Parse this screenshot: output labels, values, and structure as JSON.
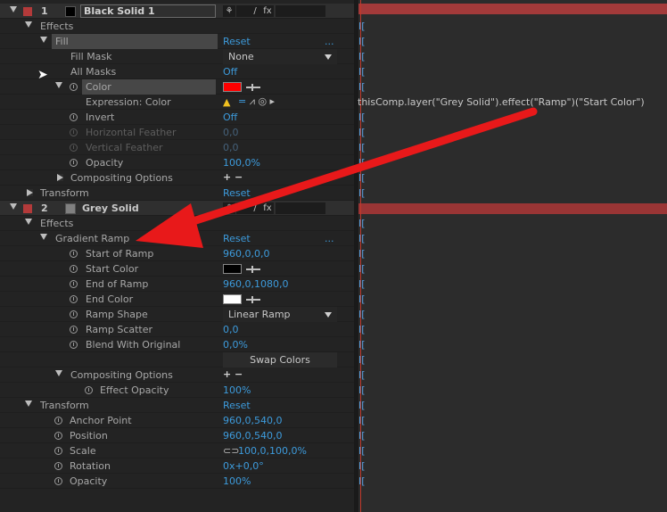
{
  "layers": [
    {
      "number": "1",
      "name": "Black Solid 1",
      "label_color": "#b33a3a",
      "source_color": "#000000"
    },
    {
      "number": "2",
      "name": "Grey Solid",
      "label_color": "#b33a3a",
      "source_color": "#808080"
    }
  ],
  "switch_labels": {
    "fx": "fx",
    "slash": "/",
    "shy": "⚘"
  },
  "rows": {
    "effects1": "Effects",
    "fill": "Fill",
    "fill_reset": "Reset",
    "fill_dots": "...",
    "fill_mask": "Fill Mask",
    "fill_mask_value": "None",
    "all_masks": "All Masks",
    "all_masks_value": "Off",
    "color": "Color",
    "color_value": "#ff0000",
    "expression_color": "Expression: Color",
    "invert": "Invert",
    "invert_value": "Off",
    "h_feather": "Horizontal Feather",
    "h_feather_value": "0,0",
    "v_feather": "Vertical Feather",
    "v_feather_value": "0,0",
    "opacity1": "Opacity",
    "opacity1_value": "100,0%",
    "comp_opts1": "Compositing Options",
    "comp_opts_value": "+ −",
    "transform1": "Transform",
    "transform1_reset": "Reset",
    "effects2": "Effects",
    "gradient_ramp": "Gradient Ramp",
    "gradient_reset": "Reset",
    "gradient_dots": "...",
    "start_of_ramp": "Start of Ramp",
    "start_of_ramp_value": "960,0,0,0",
    "start_color": "Start Color",
    "start_color_value": "#000000",
    "end_of_ramp": "End of Ramp",
    "end_of_ramp_value": "960,0,1080,0",
    "end_color": "End Color",
    "end_color_value": "#ffffff",
    "ramp_shape": "Ramp Shape",
    "ramp_shape_value": "Linear Ramp",
    "ramp_scatter": "Ramp Scatter",
    "ramp_scatter_value": "0,0",
    "blend": "Blend With Original",
    "blend_value": "0,0%",
    "swap_colors": "Swap Colors",
    "comp_opts2": "Compositing Options",
    "effect_opacity": "Effect Opacity",
    "effect_opacity_value": "100%",
    "transform2": "Transform",
    "transform2_reset": "Reset",
    "anchor_point": "Anchor Point",
    "anchor_point_value": "960,0,540,0",
    "position": "Position",
    "position_value": "960,0,540,0",
    "scale": "Scale",
    "scale_value": "100,0,100,0%",
    "rotation": "Rotation",
    "rotation_value": "0x+0,0°",
    "opacity2": "Opacity",
    "opacity2_value": "100%"
  },
  "timeline": {
    "expression_text": "thisComp.layer(\"Grey Solid\").effect(\"Ramp\")(\"Start Color\")",
    "keyframe_bracket": "I[",
    "layer_bar_color": "#a33a3a"
  }
}
